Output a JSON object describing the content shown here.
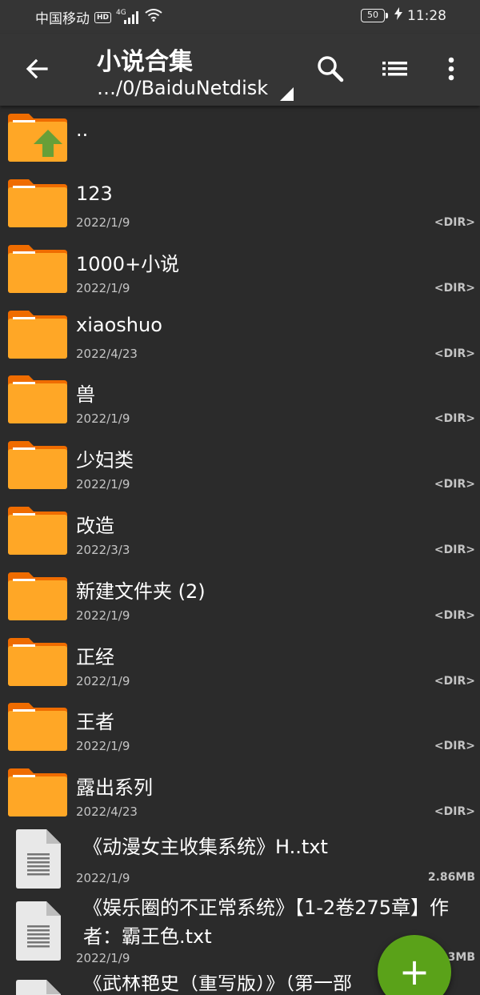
{
  "status_bar": {
    "carrier": "中国移动",
    "hd": "HD",
    "network": "4G",
    "battery": "50",
    "time": "11:28"
  },
  "toolbar": {
    "title": "小说合集",
    "path": "…/0/BaiduNetdisk",
    "icons": [
      "back-arrow-icon",
      "search-icon",
      "list-view-icon",
      "more-icon"
    ]
  },
  "parent_entry": {
    "name": ".."
  },
  "folders": [
    {
      "name": "123",
      "date": "2022/1/9",
      "tag": "<DIR>"
    },
    {
      "name": "1000+小说",
      "date": "2022/1/9",
      "tag": "<DIR>"
    },
    {
      "name": "xiaoshuo",
      "date": "2022/4/23",
      "tag": "<DIR>"
    },
    {
      "name": "兽",
      "date": "2022/1/9",
      "tag": "<DIR>"
    },
    {
      "name": "少妇类",
      "date": "2022/1/9",
      "tag": "<DIR>"
    },
    {
      "name": "改造",
      "date": "2022/3/3",
      "tag": "<DIR>"
    },
    {
      "name": "新建文件夹 (2)",
      "date": "2022/1/9",
      "tag": "<DIR>"
    },
    {
      "name": "正经",
      "date": "2022/1/9",
      "tag": "<DIR>"
    },
    {
      "name": "王者",
      "date": "2022/1/9",
      "tag": "<DIR>"
    },
    {
      "name": "露出系列",
      "date": "2022/4/23",
      "tag": "<DIR>"
    }
  ],
  "files": [
    {
      "name": "《动漫女主收集系统》H..txt",
      "date": "2022/1/9",
      "size": "2.86MB"
    },
    {
      "name": "《娱乐圈的不正常系统》【1-2卷275章】作者：霸王色.txt",
      "date": "2022/1/9",
      "size": "3MB"
    },
    {
      "name": "《武林艳史（重写版）》（第一部",
      "date": "",
      "size": ""
    }
  ],
  "fab": {
    "label": "+"
  },
  "colors": {
    "background": "#2b2b2b",
    "toolbar": "#353535",
    "folder": "#ffa726",
    "folder_tab": "#ef6c00",
    "up_arrow": "#689f38",
    "fab": "#5aa219"
  }
}
